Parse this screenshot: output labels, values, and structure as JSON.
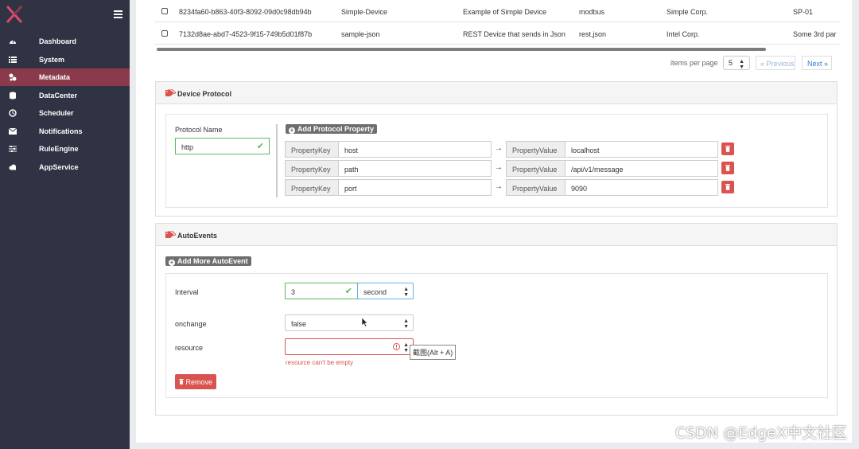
{
  "nav": {
    "items": [
      {
        "label": "Dashboard",
        "icon": "dashboard-icon"
      },
      {
        "label": "System",
        "icon": "list-icon"
      },
      {
        "label": "Metadata",
        "icon": "metadata-icon"
      },
      {
        "label": "DataCenter",
        "icon": "database-icon"
      },
      {
        "label": "Scheduler",
        "icon": "clock-icon"
      },
      {
        "label": "Notifications",
        "icon": "envelope-icon"
      },
      {
        "label": "RuleEngine",
        "icon": "sliders-icon"
      },
      {
        "label": "AppService",
        "icon": "cloud-icon"
      }
    ],
    "active": "Metadata"
  },
  "table": {
    "rows": [
      {
        "id": "8234fa60-b863-40f3-8092-09d0c98db94b",
        "name": "Simple-Device",
        "description": "Example of Simple Device",
        "labels": "modbus",
        "manufacturer": "Simple Corp.",
        "model": "SP-01"
      },
      {
        "id": "7132d8ae-abd7-4523-9f15-749b5d01f87b",
        "name": "sample-json",
        "description": "REST Device that sends in Json",
        "labels": "rest,json",
        "manufacturer": "Intel Corp.",
        "model": "Some 3rd par"
      }
    ],
    "pager": {
      "items_per_page_label": "items per page",
      "items_per_page": "5",
      "prev_label": "« Previous",
      "next_label": "Next »"
    }
  },
  "protocol": {
    "title": "Device Protocol",
    "name_label": "Protocol Name",
    "name_value": "http",
    "add_label": "Add Protocol Property",
    "key_addon": "PropertyKey",
    "value_addon": "PropertyValue",
    "arrow": "→",
    "properties": [
      {
        "key": "host",
        "value": "localhost"
      },
      {
        "key": "path",
        "value": "/api/v1/message"
      },
      {
        "key": "port",
        "value": "9090"
      }
    ]
  },
  "autoevents": {
    "title": "AutoEvents",
    "add_label": "Add More AutoEvent",
    "interval_label": "Interval",
    "interval_value": "3",
    "interval_unit": "second",
    "onchange_label": "onchange",
    "onchange_value": "false",
    "resource_label": "resource",
    "resource_value": "",
    "resource_error": "resource can't be empty",
    "remove_label": "Remove"
  },
  "tooltip": "截图(Alt + A)",
  "watermark": "CSDN @EdgeX中文社区",
  "colors": {
    "sidebar": "#2f3343",
    "active_nav": "#8a3a4a",
    "danger": "#d9534f",
    "success": "#5cb85c",
    "link": "#2a7ad2"
  }
}
